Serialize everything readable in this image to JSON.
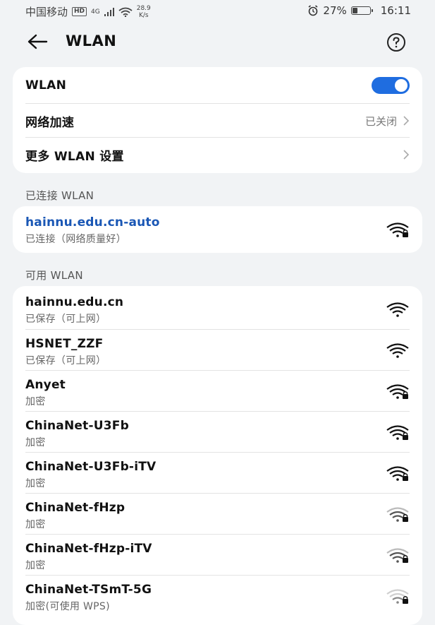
{
  "status_bar": {
    "carrier": "中国移动",
    "hd": "HD",
    "signal_tag": "4G",
    "speed_value": "28.9",
    "speed_unit": "K/s",
    "battery_percent": "27%",
    "battery_level": 0.27,
    "time": "16:11"
  },
  "header": {
    "title": "WLAN"
  },
  "settings": {
    "wlan_label": "WLAN",
    "wlan_enabled": true,
    "accel_label": "网络加速",
    "accel_status": "已关闭",
    "more_label": "更多 WLAN 设置"
  },
  "connected": {
    "section_title": "已连接 WLAN",
    "name": "hainnu.edu.cn-auto",
    "status": "已连接（网络质量好）"
  },
  "available": {
    "section_title": "可用 WLAN",
    "networks": [
      {
        "name": "hainnu.edu.cn",
        "status": "已保存（可上网）",
        "locked": false,
        "strength": "strong"
      },
      {
        "name": "HSNET_ZZF",
        "status": "已保存（可上网）",
        "locked": false,
        "strength": "strong"
      },
      {
        "name": "Anyet",
        "status": "加密",
        "locked": true,
        "strength": "strong"
      },
      {
        "name": "ChinaNet-U3Fb",
        "status": "加密",
        "locked": true,
        "strength": "strong"
      },
      {
        "name": "ChinaNet-U3Fb-iTV",
        "status": "加密",
        "locked": true,
        "strength": "strong"
      },
      {
        "name": "ChinaNet-fHzp",
        "status": "加密",
        "locked": true,
        "strength": "medium"
      },
      {
        "name": "ChinaNet-fHzp-iTV",
        "status": "加密",
        "locked": true,
        "strength": "medium"
      },
      {
        "name": "ChinaNet-TSmT-5G",
        "status": "加密(可使用 WPS)",
        "locked": true,
        "strength": "weak"
      }
    ]
  },
  "colors": {
    "accent": "#1f6de0",
    "connected_text": "#1a57b5",
    "background": "#f1f3f5"
  }
}
